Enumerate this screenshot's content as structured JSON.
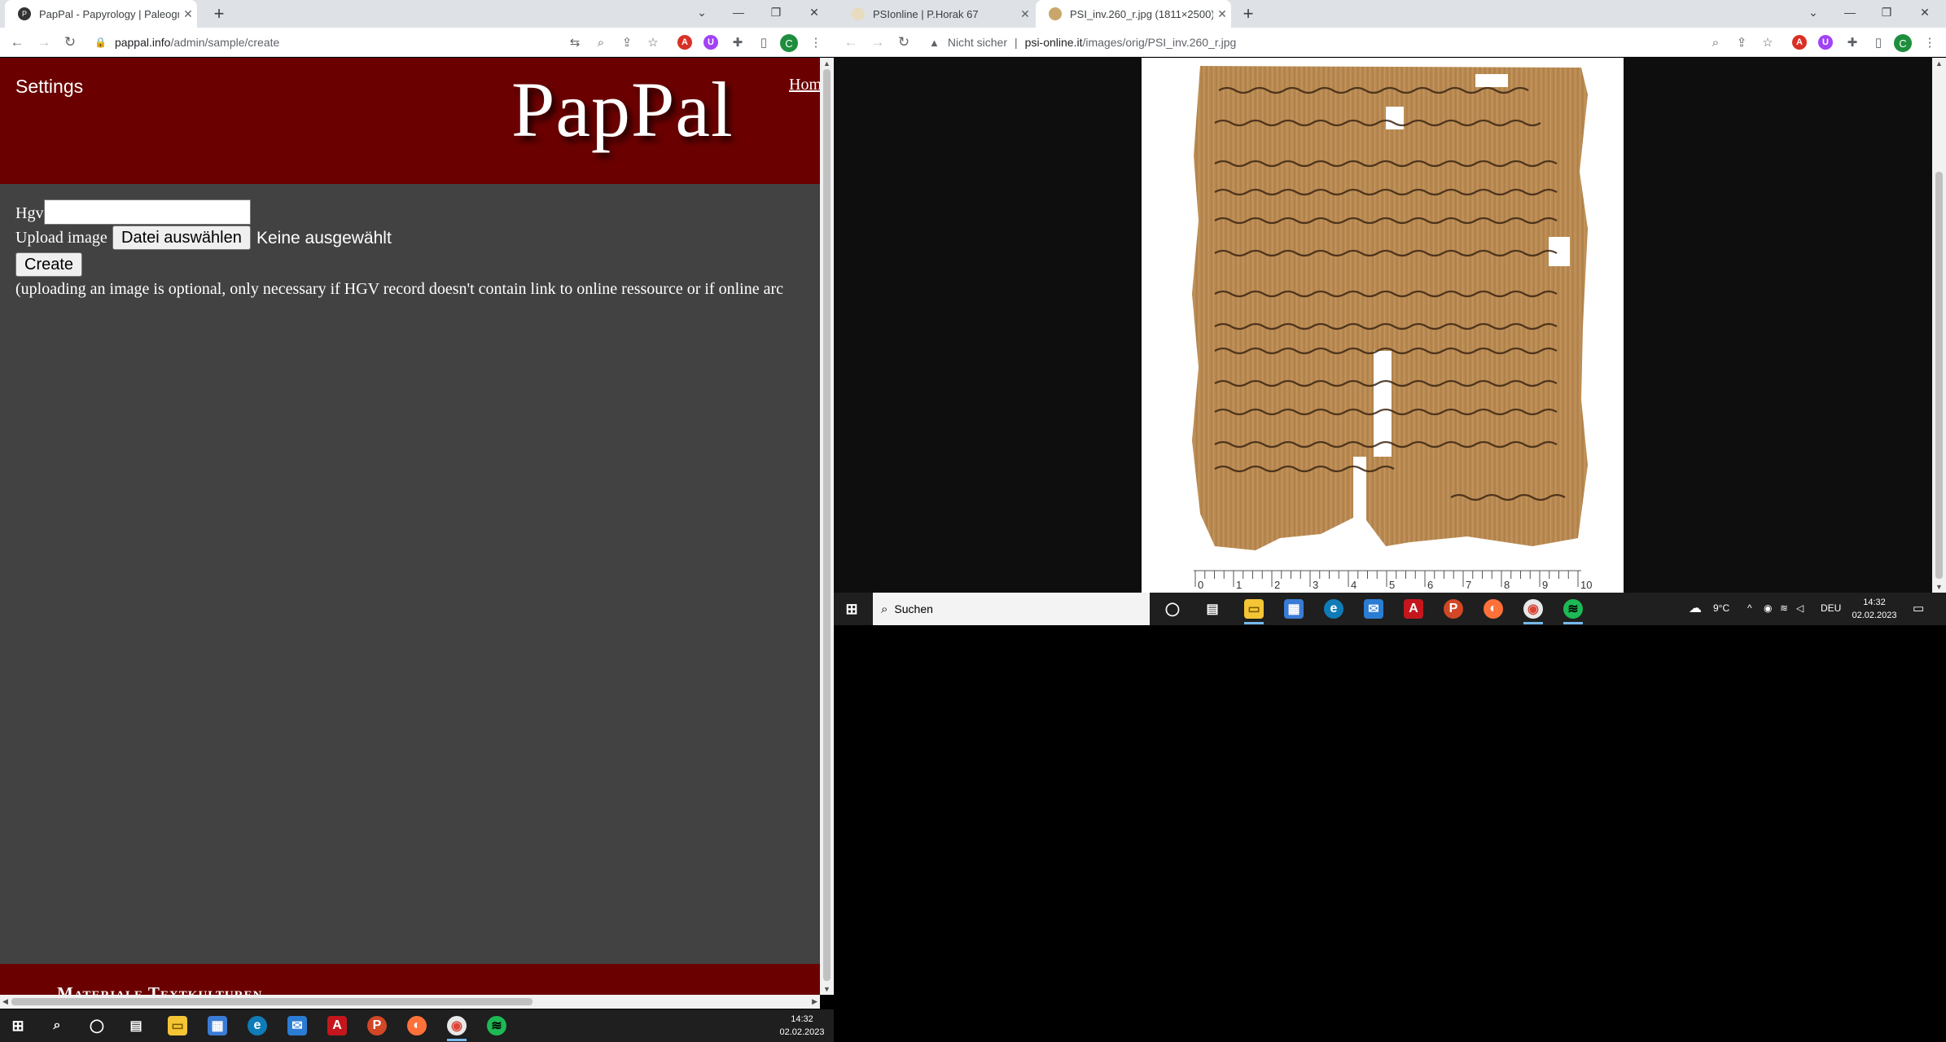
{
  "left_browser": {
    "tab": {
      "title": "PapPal - Papyrology | Paleograph"
    },
    "url": {
      "host": "pappal.info",
      "path": "/admin/sample/create"
    },
    "avatar_letter": "C"
  },
  "pappal": {
    "settings_label": "Settings",
    "logo_text": "PapPal",
    "home_link": "Hom",
    "form": {
      "hgv_label": "Hgv",
      "hgv_value": "",
      "upload_label": "Upload image",
      "file_button": "Datei auswählen",
      "file_status": "Keine ausgewählt",
      "create_button": "Create",
      "note": "(uploading an image is optional, only necessary if HGV record doesn't contain link to online ressource or if online arc"
    },
    "footer_text": "Materiale Textkulturen",
    "colors": {
      "header": "#6b0000",
      "body": "#424242"
    }
  },
  "right_browser": {
    "tabs": [
      {
        "title": "PSIonline | P.Horak 67"
      },
      {
        "title": "PSI_inv.260_r.jpg (1811×2500)"
      }
    ],
    "security_label": "Nicht sicher",
    "url": {
      "host": "psi-online.it",
      "path": "/images/orig/PSI_inv.260_r.jpg"
    },
    "avatar_letter": "C",
    "ruler_labels": [
      "0",
      "1",
      "2",
      "3",
      "4",
      "5",
      "6",
      "7",
      "8",
      "9",
      "10"
    ]
  },
  "taskbar_left": {
    "time": "14:32",
    "date": "02.02.2023"
  },
  "taskbar_right": {
    "search_placeholder": "Suchen",
    "temperature": "9°C",
    "language": "DEU",
    "time": "14:32",
    "date": "02.02.2023"
  }
}
